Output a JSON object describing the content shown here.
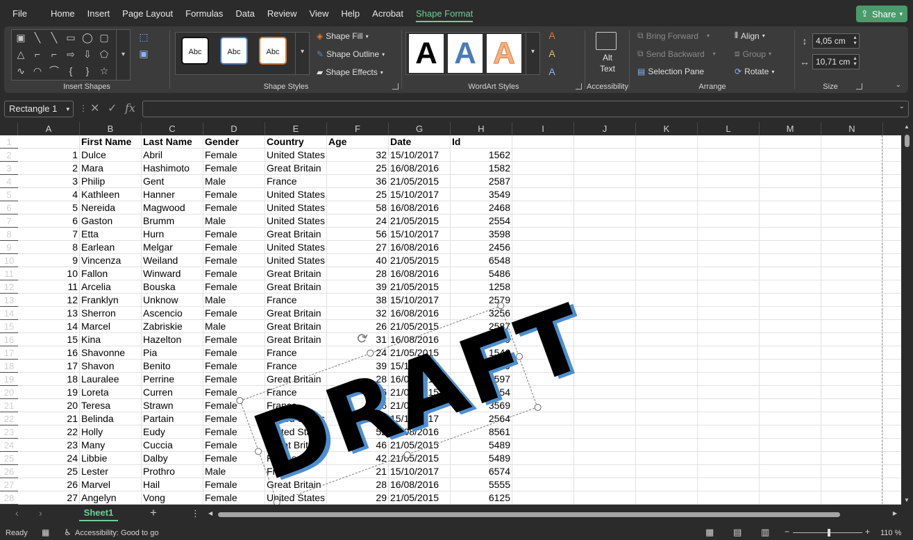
{
  "menu": [
    "File",
    "Home",
    "Insert",
    "Page Layout",
    "Formulas",
    "Data",
    "Review",
    "View",
    "Help",
    "Acrobat",
    "Shape Format"
  ],
  "share_label": "Share",
  "ribbon": {
    "insert_shapes_label": "Insert Shapes",
    "shape_styles_label": "Shape Styles",
    "shape_fill": "Shape Fill",
    "shape_outline": "Shape Outline",
    "shape_effects": "Shape Effects",
    "abc": "Abc",
    "wordart_label": "WordArt Styles",
    "wordart_letter": "A",
    "alt_text_1": "Alt",
    "alt_text_2": "Text",
    "accessibility_label": "Accessibility",
    "bring_forward": "Bring Forward",
    "send_backward": "Send Backward",
    "selection_pane": "Selection Pane",
    "align": "Align",
    "group": "Group",
    "rotate": "Rotate",
    "arrange_label": "Arrange",
    "height": "4,05 cm",
    "width": "10,71 cm",
    "size_label": "Size"
  },
  "name_box": "Rectangle 1",
  "columns": [
    "A",
    "B",
    "C",
    "D",
    "E",
    "F",
    "G",
    "H",
    "I",
    "J",
    "K",
    "L",
    "M",
    "N"
  ],
  "rows": [
    "1",
    "2",
    "3",
    "4",
    "5",
    "6",
    "7",
    "8",
    "9",
    "10",
    "11",
    "12",
    "13",
    "14",
    "15",
    "16",
    "17",
    "18",
    "19",
    "20",
    "21",
    "22",
    "23",
    "24",
    "25",
    "26",
    "27",
    "28"
  ],
  "headers": [
    "",
    "First Name",
    "Last Name",
    "Gender",
    "Country",
    "Age",
    "Date",
    "Id"
  ],
  "data": [
    [
      "1",
      "Dulce",
      "Abril",
      "Female",
      "United States",
      "32",
      "15/10/2017",
      "1562"
    ],
    [
      "2",
      "Mara",
      "Hashimoto",
      "Female",
      "Great Britain",
      "25",
      "16/08/2016",
      "1582"
    ],
    [
      "3",
      "Philip",
      "Gent",
      "Male",
      "France",
      "36",
      "21/05/2015",
      "2587"
    ],
    [
      "4",
      "Kathleen",
      "Hanner",
      "Female",
      "United States",
      "25",
      "15/10/2017",
      "3549"
    ],
    [
      "5",
      "Nereida",
      "Magwood",
      "Female",
      "United States",
      "58",
      "16/08/2016",
      "2468"
    ],
    [
      "6",
      "Gaston",
      "Brumm",
      "Male",
      "United States",
      "24",
      "21/05/2015",
      "2554"
    ],
    [
      "7",
      "Etta",
      "Hurn",
      "Female",
      "Great Britain",
      "56",
      "15/10/2017",
      "3598"
    ],
    [
      "8",
      "Earlean",
      "Melgar",
      "Female",
      "United States",
      "27",
      "16/08/2016",
      "2456"
    ],
    [
      "9",
      "Vincenza",
      "Weiland",
      "Female",
      "United States",
      "40",
      "21/05/2015",
      "6548"
    ],
    [
      "10",
      "Fallon",
      "Winward",
      "Female",
      "Great Britain",
      "28",
      "16/08/2016",
      "5486"
    ],
    [
      "11",
      "Arcelia",
      "Bouska",
      "Female",
      "Great Britain",
      "39",
      "21/05/2015",
      "1258"
    ],
    [
      "12",
      "Franklyn",
      "Unknow",
      "Male",
      "France",
      "38",
      "15/10/2017",
      "2579"
    ],
    [
      "13",
      "Sherron",
      "Ascencio",
      "Female",
      "Great Britain",
      "32",
      "16/08/2016",
      "3256"
    ],
    [
      "14",
      "Marcel",
      "Zabriskie",
      "Male",
      "Great Britain",
      "26",
      "21/05/2015",
      "2587"
    ],
    [
      "15",
      "Kina",
      "Hazelton",
      "Female",
      "Great Britain",
      "31",
      "16/08/2016",
      "3259"
    ],
    [
      "16",
      "Shavonne",
      "Pia",
      "Female",
      "France",
      "24",
      "21/05/2015",
      "1546"
    ],
    [
      "17",
      "Shavon",
      "Benito",
      "Female",
      "France",
      "39",
      "15/10/2017",
      "3579"
    ],
    [
      "18",
      "Lauralee",
      "Perrine",
      "Female",
      "Great Britain",
      "28",
      "16/08/2016",
      "6597"
    ],
    [
      "19",
      "Loreta",
      "Curren",
      "Female",
      "France",
      "26",
      "21/05/2015",
      "9654"
    ],
    [
      "20",
      "Teresa",
      "Strawn",
      "Female",
      "France",
      "46",
      "21/05/2015",
      "3569"
    ],
    [
      "21",
      "Belinda",
      "Partain",
      "Female",
      "United States",
      "37",
      "15/10/2017",
      "2564"
    ],
    [
      "22",
      "Holly",
      "Eudy",
      "Female",
      "United States",
      "52",
      "16/08/2016",
      "8561"
    ],
    [
      "23",
      "Many",
      "Cuccia",
      "Female",
      "Great Britain",
      "46",
      "21/05/2015",
      "5489"
    ],
    [
      "24",
      "Libbie",
      "Dalby",
      "Female",
      "France",
      "42",
      "21/05/2015",
      "5489"
    ],
    [
      "25",
      "Lester",
      "Prothro",
      "Male",
      "France",
      "21",
      "15/10/2017",
      "6574"
    ],
    [
      "26",
      "Marvel",
      "Hail",
      "Female",
      "Great Britain",
      "28",
      "16/08/2016",
      "5555"
    ],
    [
      "27",
      "Angelyn",
      "Vong",
      "Female",
      "United States",
      "29",
      "21/05/2015",
      "6125"
    ]
  ],
  "draft_text": "DRAFT",
  "sheet_tab": "Sheet1",
  "status": {
    "ready": "Ready",
    "accessibility": "Accessibility: Good to go",
    "zoom": "110 %"
  }
}
